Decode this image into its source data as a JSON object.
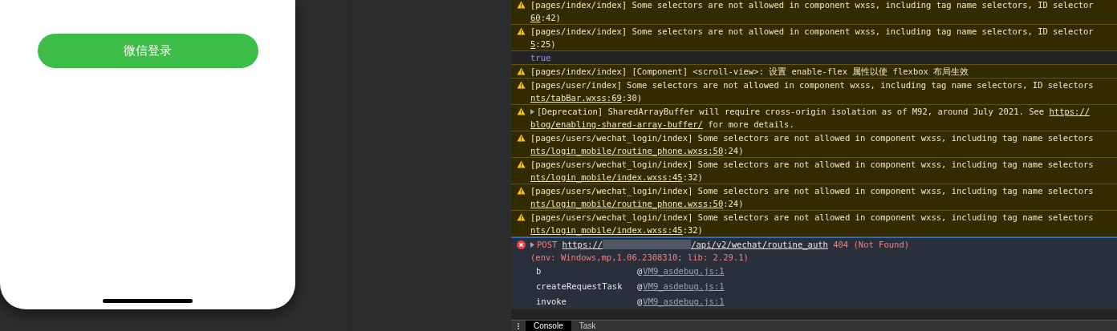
{
  "phone": {
    "login_button": "微信登录"
  },
  "console": {
    "messages": [
      {
        "kind": "warning",
        "expandable": false,
        "line1": [
          {
            "text": "[pages/index/index] Some selectors are not allowed in component wxss, including tag name selectors, ID selector"
          }
        ],
        "line2": [
          {
            "text": "60",
            "link": true
          },
          {
            "text": ":42)"
          }
        ]
      },
      {
        "kind": "warning",
        "expandable": false,
        "line1": [
          {
            "text": "[pages/index/index] Some selectors are not allowed in component wxss, including tag name selectors, ID selector"
          }
        ],
        "line2": [
          {
            "text": "5",
            "link": true
          },
          {
            "text": ":25)"
          }
        ]
      },
      {
        "kind": "value",
        "expandable": false,
        "line1": [
          {
            "text": "true"
          }
        ]
      },
      {
        "kind": "warning",
        "expandable": false,
        "line1": [
          {
            "text": "[pages/index/index] [Component] <scroll-view>: 设置 enable-flex 属性以使 flexbox 布局生效"
          }
        ]
      },
      {
        "kind": "warning",
        "expandable": false,
        "line1": [
          {
            "text": "[pages/user/index] Some selectors are not allowed in component wxss, including tag name selectors, ID selectors"
          }
        ],
        "line2": [
          {
            "text": "nts/tabBar.wxss:69",
            "link": true
          },
          {
            "text": ":30)"
          }
        ]
      },
      {
        "kind": "warning",
        "expandable": true,
        "line1": [
          {
            "text": "[Deprecation] SharedArrayBuffer will require cross-origin isolation as of M92, around July 2021. See "
          },
          {
            "text": "https://",
            "link": true
          }
        ],
        "line2": [
          {
            "text": "blog/enabling-shared-array-buffer/",
            "link": true
          },
          {
            "text": " for more details."
          }
        ]
      },
      {
        "kind": "warning",
        "expandable": false,
        "line1": [
          {
            "text": "[pages/users/wechat_login/index] Some selectors are not allowed in component wxss, including tag name selectors"
          }
        ],
        "line2": [
          {
            "text": "nts/login_mobile/routine_phone.wxss:50",
            "link": true
          },
          {
            "text": ":24)"
          }
        ]
      },
      {
        "kind": "warning",
        "expandable": false,
        "line1": [
          {
            "text": "[pages/users/wechat_login/index] Some selectors are not allowed in component wxss, including tag name selectors"
          }
        ],
        "line2": [
          {
            "text": "nts/login_mobile/index.wxss:45",
            "link": true
          },
          {
            "text": ":32)"
          }
        ]
      },
      {
        "kind": "warning",
        "expandable": false,
        "line1": [
          {
            "text": "[pages/users/wechat_login/index] Some selectors are not allowed in component wxss, including tag name selectors"
          }
        ],
        "line2": [
          {
            "text": "nts/login_mobile/routine_phone.wxss:50",
            "link": true
          },
          {
            "text": ":24)"
          }
        ]
      },
      {
        "kind": "warning",
        "expandable": false,
        "line1": [
          {
            "text": "[pages/users/wechat_login/index] Some selectors are not allowed in component wxss, including tag name selectors"
          }
        ],
        "line2": [
          {
            "text": "nts/login_mobile/index.wxss:45",
            "link": true
          },
          {
            "text": ":32)"
          }
        ]
      },
      {
        "kind": "error",
        "expandable": true,
        "line1": [
          {
            "text": "POST "
          },
          {
            "text": "https://",
            "link": true
          },
          {
            "redacted": true
          },
          {
            "text": "/api/v2/wechat/routine_auth",
            "link": true
          },
          {
            "text": " 404 (Not Found)"
          }
        ],
        "line2": [
          {
            "text": "(env: Windows,mp,1.06.2308310; lib: 2.29.1)"
          }
        ],
        "stack": [
          {
            "function": "b",
            "source": "VM9_asdebug.js:1"
          },
          {
            "function": "createRequestTask",
            "source": "VM9_asdebug.js:1"
          },
          {
            "function": "invoke",
            "source": "VM9_asdebug.js:1"
          }
        ]
      }
    ],
    "stack_at": "@",
    "tabs": [
      {
        "label": "Console",
        "selected": true
      },
      {
        "label": "Task",
        "selected": false
      }
    ]
  }
}
